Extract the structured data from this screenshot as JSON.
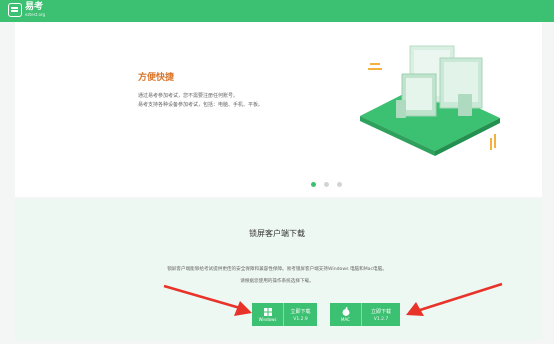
{
  "header": {
    "brand_cn": "易考",
    "brand_en": "eztest.org"
  },
  "banner": {
    "title": "方便快捷",
    "description_line1": "通过易考参加考试，您不需要注册任何账号。",
    "description_line2": "易考支持各种设备参加考试，包括：电脑、手机、平板。",
    "carousel_dots": 3,
    "active_dot": 0
  },
  "download": {
    "title": "锁屏客户端下载",
    "desc_line1": "锁屏客户端能够给考试提供更佳的安全保障和兼容性保障。易考锁屏客户端支持Windows 电脑和Mac电脑。",
    "desc_line2": "请根据您使用的操作系统选择下载。",
    "windows": {
      "os_label": "Windows",
      "button_label": "立即下载",
      "version": "V1.2.9"
    },
    "mac": {
      "os_label": "MAC",
      "button_label": "立即下载",
      "version": "V1.2.7"
    }
  },
  "colors": {
    "brand_green": "#3cc071",
    "title_orange": "#d9752a",
    "arrow_red": "#e8332a"
  }
}
